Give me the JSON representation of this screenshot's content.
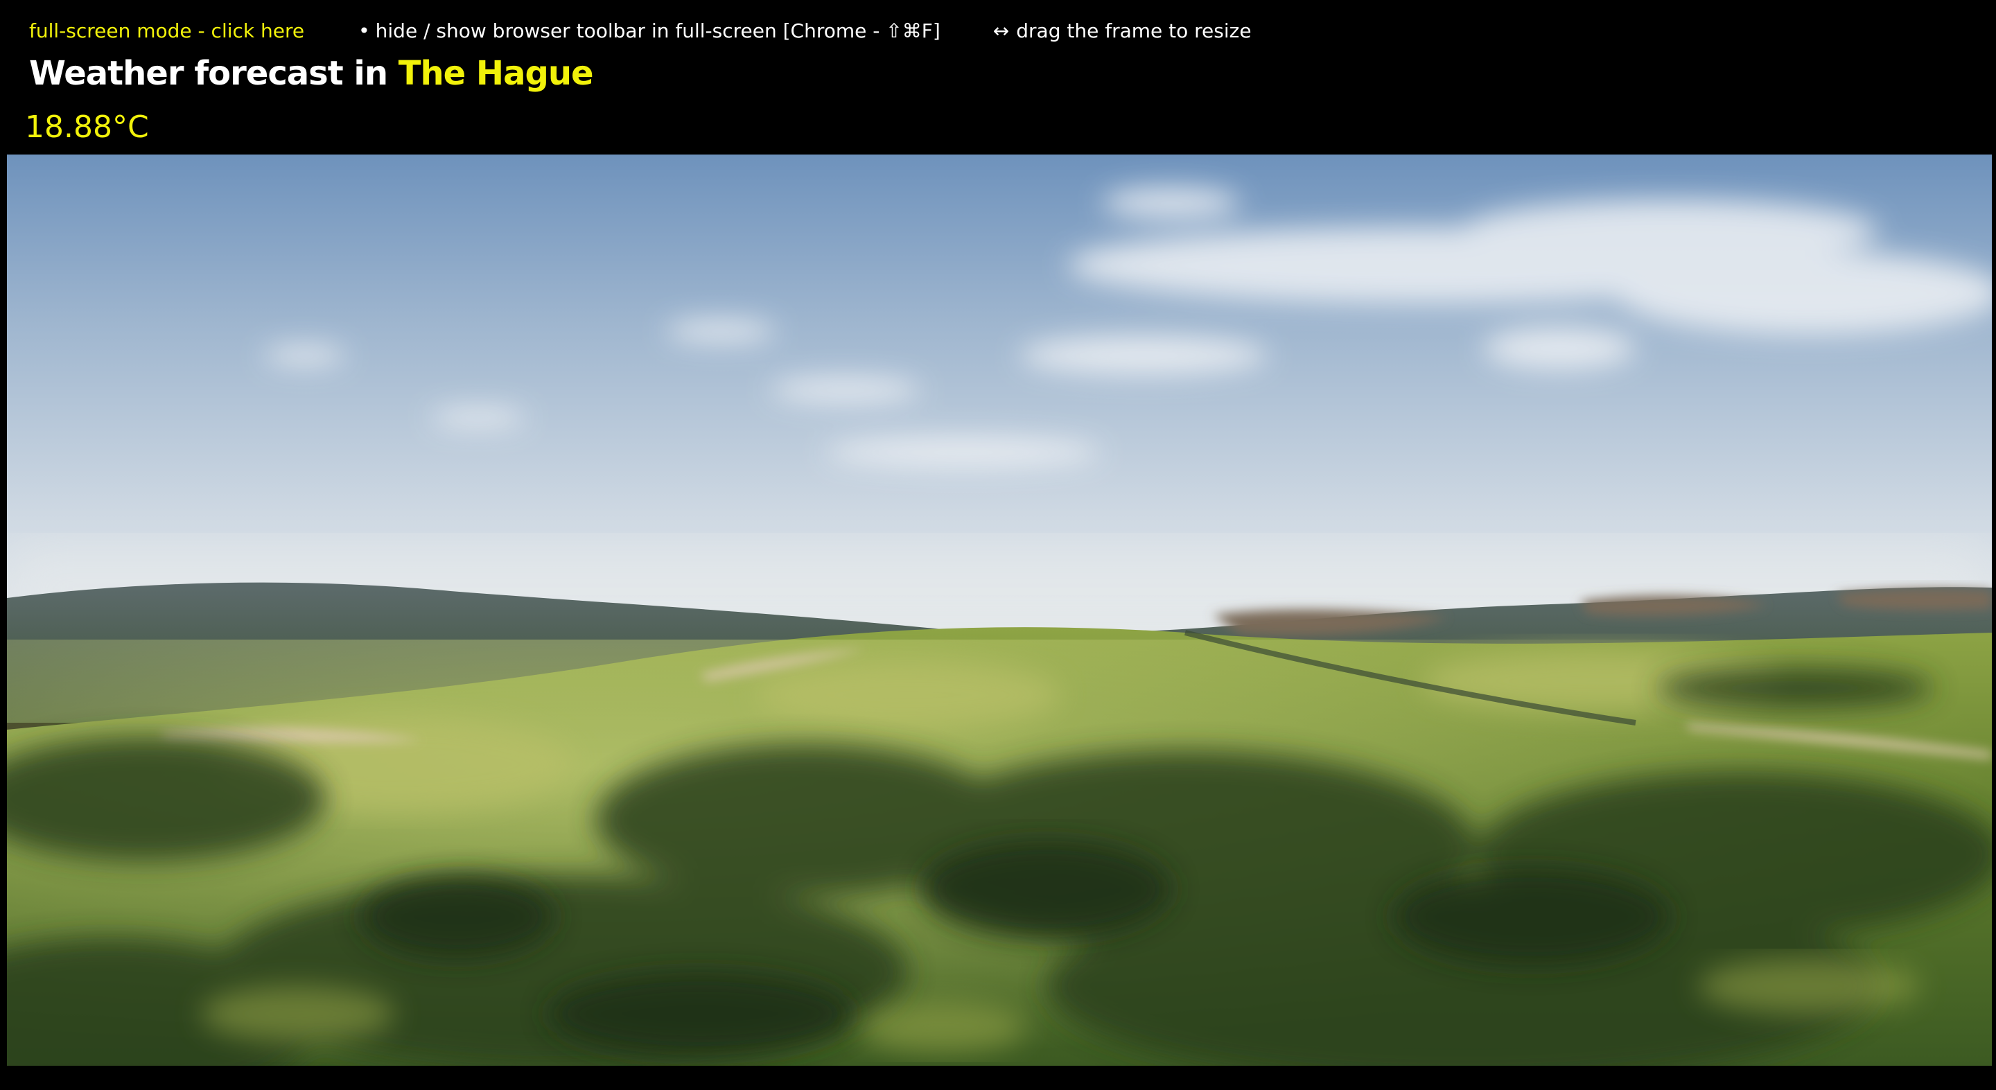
{
  "topbar": {
    "fullscreen_link": "full-screen mode - click here",
    "toolbar_hint_bullet": "•",
    "toolbar_hint": "hide / show browser toolbar in full-screen [Chrome - ⇧⌘F]",
    "resize_hint_icon": "↔",
    "resize_hint": "drag the frame to resize"
  },
  "header": {
    "title_prefix": "Weather forecast in",
    "city": "The Hague"
  },
  "weather": {
    "temperature": "18.88°C"
  },
  "scene": {
    "description_icon": "landscape-image",
    "sky_color_top": "#6f93bd",
    "sky_color_horizon": "#dce3e8",
    "grass_color": "#7f9a3c",
    "forest_color": "#2e4a22"
  },
  "colors": {
    "background": "#000000",
    "accent": "#f2f20a",
    "text": "#ffffff"
  }
}
